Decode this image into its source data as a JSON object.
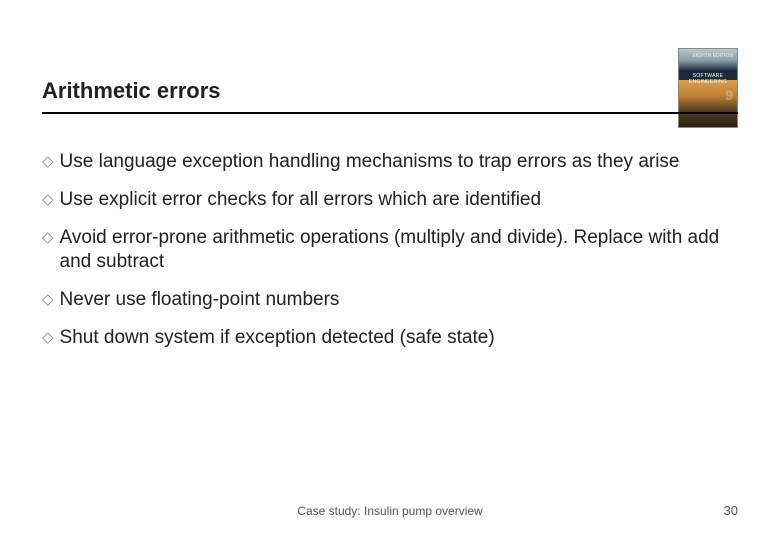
{
  "header": {
    "title": "Arithmetic errors"
  },
  "book": {
    "edition": "EIGHTH EDITION",
    "title": "SOFTWARE ENGINEERING",
    "nine": "9"
  },
  "bullets": [
    {
      "text": "Use language exception handling mechanisms to trap errors as they arise"
    },
    {
      "text": "Use explicit error checks for all errors which are identified"
    },
    {
      "text": "Avoid error-prone arithmetic operations (multiply and divide). Replace with add and subtract"
    },
    {
      "text": "Never use floating-point numbers"
    },
    {
      "text": "Shut down system if exception detected (safe state)"
    }
  ],
  "footer": {
    "case_study": "Case study: Insulin pump overview",
    "page_number": "30"
  },
  "icons": {
    "diamond": "◇"
  }
}
